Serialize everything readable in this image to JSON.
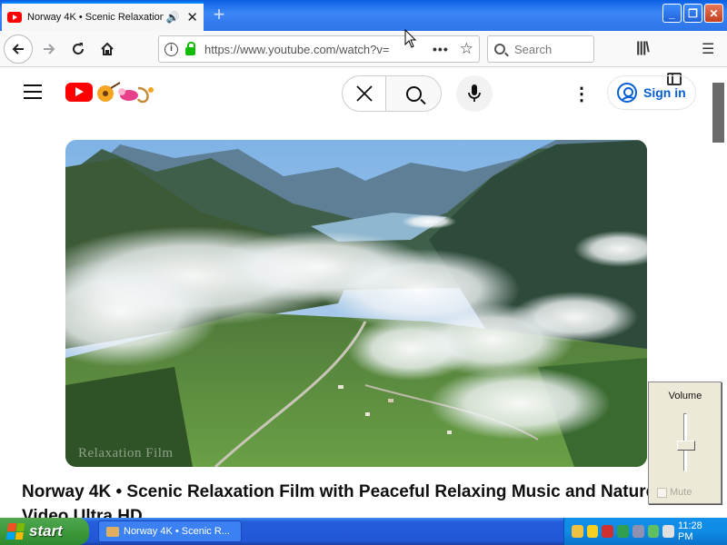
{
  "browser": {
    "tab_title": "Norway 4K • Scenic Relaxation",
    "tab_audio_icon": "speaker-icon",
    "new_tab_label": "+",
    "url": "https://www.youtube.com/watch?v=",
    "search_placeholder": "Search",
    "page_actions_label": "•••"
  },
  "youtube": {
    "signin_label": "Sign in",
    "video_title": "Norway 4K • Scenic Relaxation Film with Peaceful Relaxing Music and Nature Video Ultra HD",
    "watermark": "Relaxation Film"
  },
  "volume_popup": {
    "title": "Volume",
    "mute_label": "Mute",
    "muted": false
  },
  "taskbar": {
    "start_label": "start",
    "task_label": "Norway 4K • Scenic R...",
    "clock": "11:28 PM"
  },
  "colors": {
    "youtube_red": "#ff0000",
    "signin_blue": "#065fd4",
    "xp_blue": "#245edb",
    "xp_green": "#3c9a3c"
  }
}
